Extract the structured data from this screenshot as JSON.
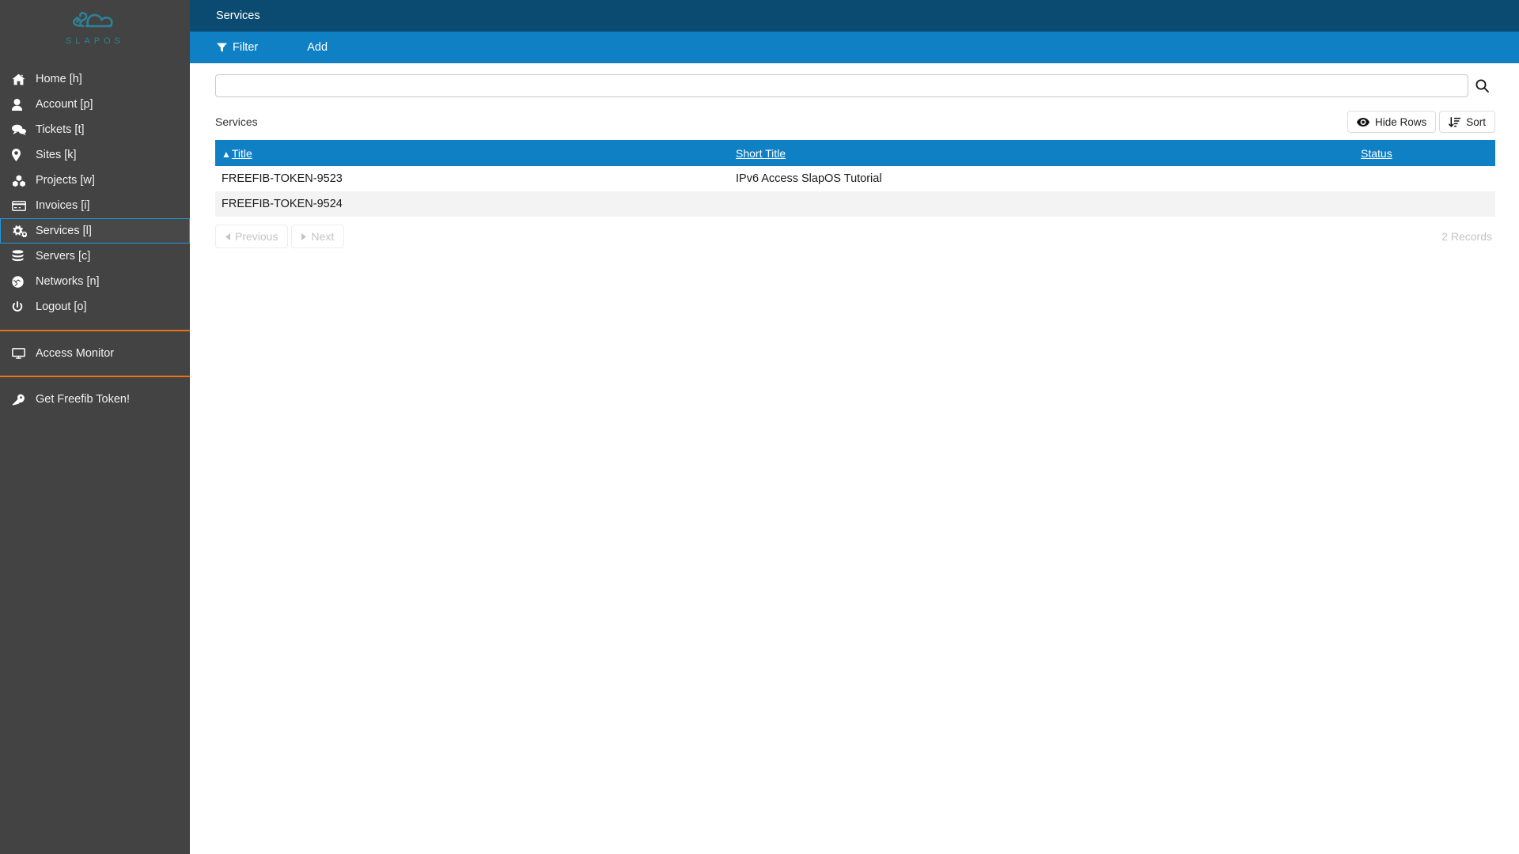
{
  "brand": {
    "logo_icon": "slapos-cloud-logo",
    "wordmark": "SLAPOS",
    "logo_color": "#2d8296",
    "divider_color": "#e8711a"
  },
  "sidebar": {
    "background": "#434343",
    "selected_outline_color": "#2196d9",
    "items": [
      {
        "label": "Home [h]",
        "icon": "home-icon",
        "selected": false
      },
      {
        "label": "Account [p]",
        "icon": "user-icon",
        "selected": false
      },
      {
        "label": "Tickets [t]",
        "icon": "comments-icon",
        "selected": false
      },
      {
        "label": "Sites [k]",
        "icon": "map-pin-icon",
        "selected": false
      },
      {
        "label": "Projects [w]",
        "icon": "cubes-icon",
        "selected": false
      },
      {
        "label": "Invoices [i]",
        "icon": "credit-card-icon",
        "selected": false
      },
      {
        "label": "Services [l]",
        "icon": "cogs-icon",
        "selected": true
      },
      {
        "label": "Servers [c]",
        "icon": "database-icon",
        "selected": false
      },
      {
        "label": "Networks [n]",
        "icon": "globe-icon",
        "selected": false
      },
      {
        "label": "Logout [o]",
        "icon": "power-icon",
        "selected": false
      }
    ],
    "extra_sections": [
      {
        "label": "Access Monitor",
        "icon": "monitor-icon"
      },
      {
        "label": "Get Freefib Token!",
        "icon": "key-icon"
      }
    ]
  },
  "header": {
    "title": "Services",
    "background": "#0b4b72"
  },
  "toolbar": {
    "background": "#1080c4",
    "filter_label": "Filter",
    "filter_icon": "filter-icon",
    "add_label": "Add"
  },
  "search": {
    "value": "",
    "placeholder": "",
    "button_icon": "search-icon"
  },
  "list": {
    "title": "Services",
    "hide_rows_label": "Hide Rows",
    "hide_rows_icon": "eye-icon",
    "sort_label": "Sort",
    "sort_icon": "sort-amount-icon",
    "columns": [
      {
        "label": "Title",
        "sorted": true,
        "sort_direction": "asc",
        "sort_icon": "arrow-up-icon"
      },
      {
        "label": "Short Title",
        "sorted": false,
        "sort_direction": "",
        "sort_icon": ""
      },
      {
        "label": "Status",
        "sorted": false,
        "sort_direction": "",
        "sort_icon": ""
      }
    ],
    "rows": [
      {
        "title": "FREEFIB-TOKEN-9523",
        "short_title": "IPv6 Access SlapOS Tutorial",
        "status": ""
      },
      {
        "title": "FREEFIB-TOKEN-9524",
        "short_title": "",
        "status": ""
      }
    ],
    "header_background": "#1080c4"
  },
  "footer": {
    "previous_label": "Previous",
    "previous_icon": "caret-left-icon",
    "previous_disabled": true,
    "next_label": "Next",
    "next_icon": "caret-right-icon",
    "next_disabled": true,
    "records_label": "2 Records"
  }
}
